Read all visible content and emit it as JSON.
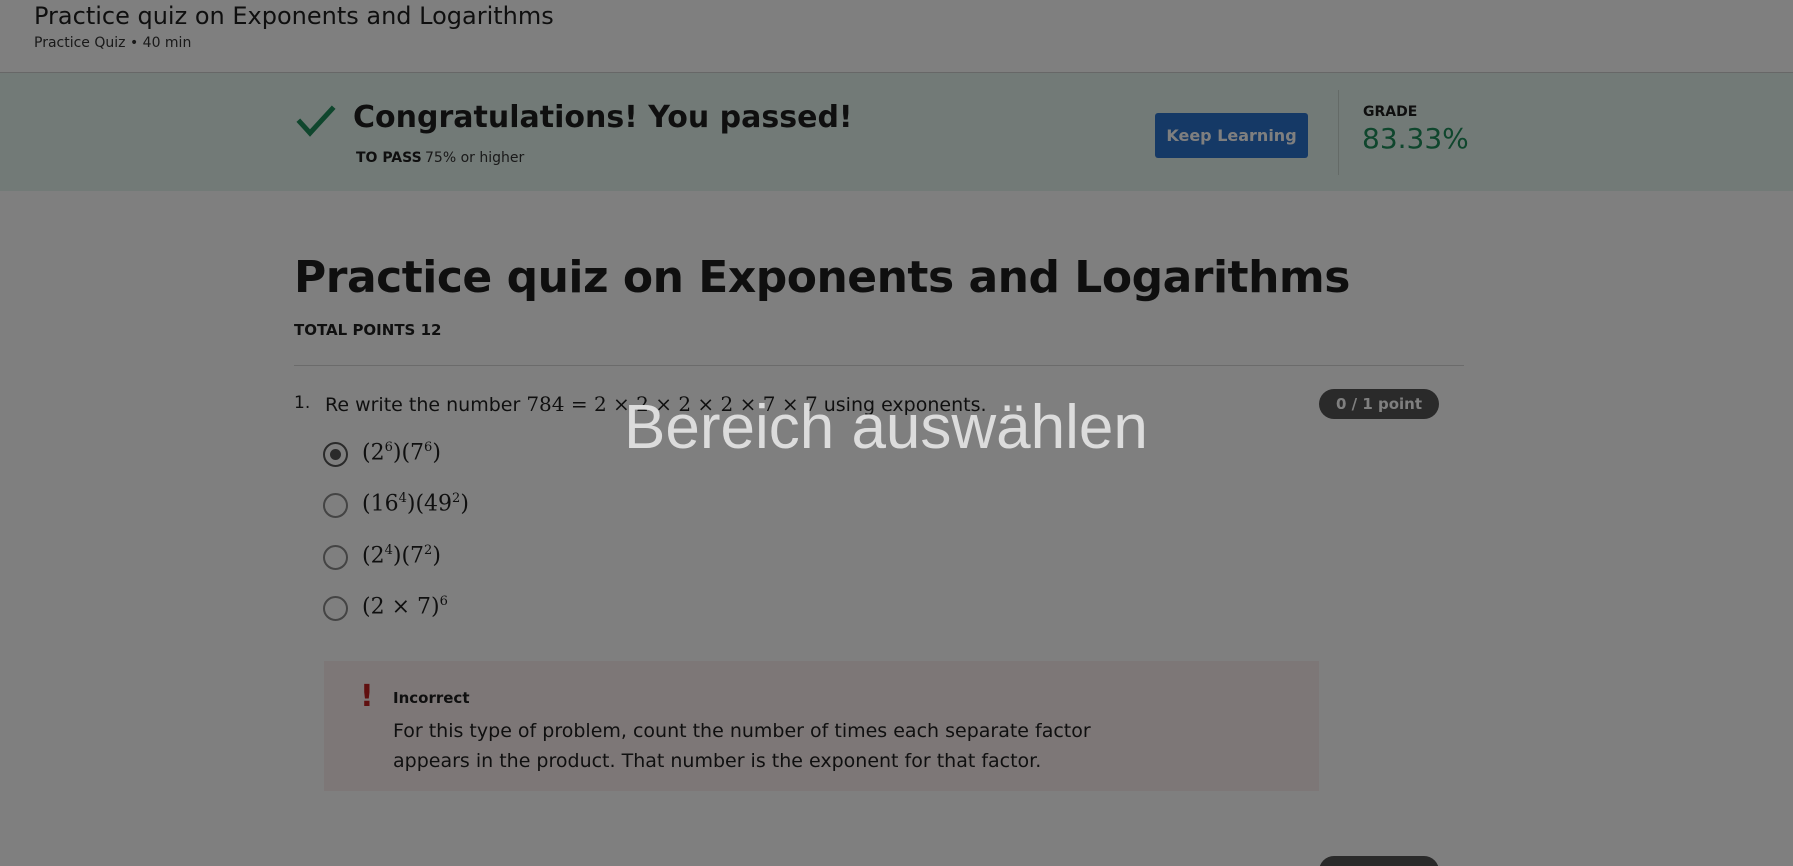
{
  "header": {
    "title": "Practice quiz on Exponents and Logarithms",
    "subtitle": "Practice Quiz • 40 min"
  },
  "banner": {
    "title": "Congratulations! You passed!",
    "to_pass_label": "TO PASS",
    "to_pass_value": "75% or higher",
    "keep_learning_label": "Keep Learning",
    "grade_label": "GRADE",
    "grade_value": "83.33%",
    "colors": {
      "banner_bg": "#e5f4ee",
      "check": "#1e8c5a",
      "button": "#2a73cc"
    }
  },
  "quiz": {
    "title": "Practice quiz on Exponents and Logarithms",
    "total_points": "TOTAL POINTS 12"
  },
  "question1": {
    "number": "1.",
    "text_before": "Re write the number",
    "math": "784 = 2 × 2 × 2 × 2 × 7 × 7",
    "text_after": "using exponents.",
    "points": "0 / 1 point",
    "options": [
      {
        "base1": "2",
        "exp1": "6",
        "base2": "7",
        "exp2": "6",
        "selected": true
      },
      {
        "base1": "16",
        "exp1": "4",
        "base2": "49",
        "exp2": "2",
        "selected": false
      },
      {
        "base1": "2",
        "exp1": "4",
        "base2": "7",
        "exp2": "2",
        "selected": false
      },
      {
        "text": "(2 × 7)",
        "exp": "6",
        "selected": false
      }
    ],
    "feedback": {
      "label": "Incorrect",
      "text": "For this type of problem, count the number of times each separate factor appears in the product. That number is the exponent for that factor.",
      "color": "#c02020"
    }
  },
  "overlay": {
    "text": "Bereich auswählen"
  }
}
